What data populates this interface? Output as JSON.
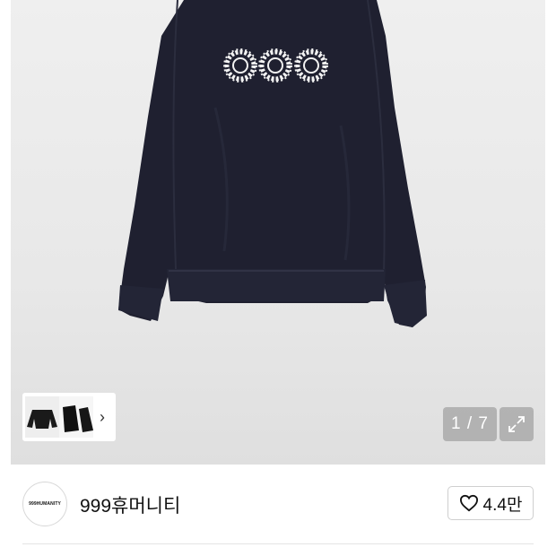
{
  "gallery": {
    "counter": "1 / 7",
    "thumbnails_arrow": "›"
  },
  "icons": {
    "expand": "expand-icon",
    "heart": "heart-icon",
    "chevron": "chevron-right-icon"
  },
  "shop": {
    "logo_text": "999HUMANITY",
    "name": "999휴머니티",
    "likes": "4.4만"
  },
  "colors": {
    "sweatshirt": "#1f2030",
    "print": "#f2f2f2",
    "overlay": "#8c8c8c"
  }
}
